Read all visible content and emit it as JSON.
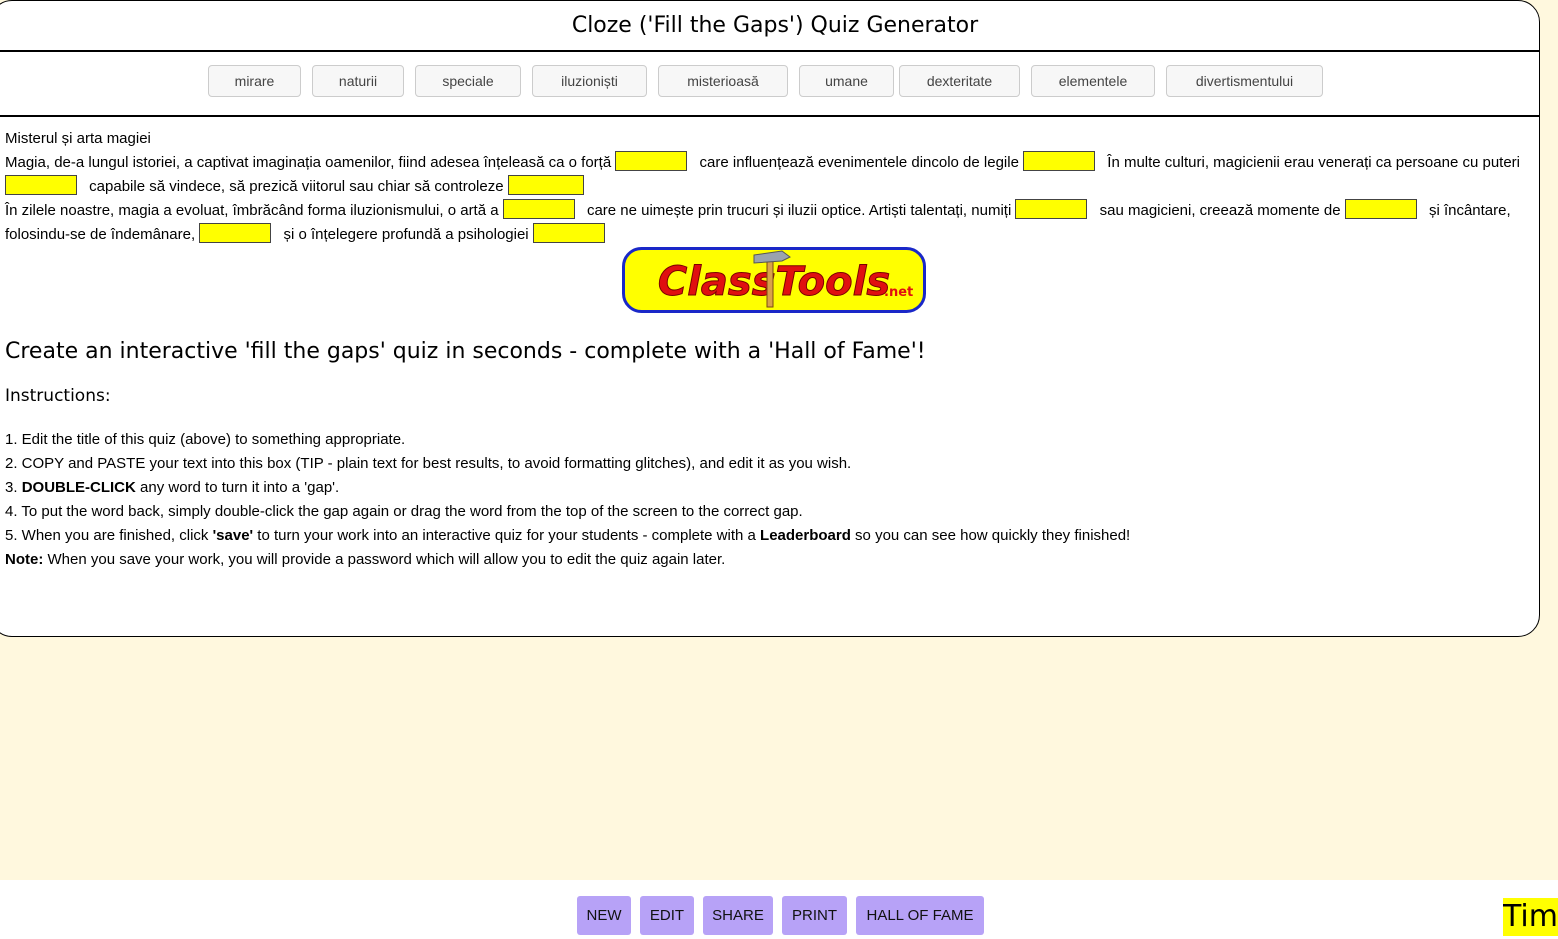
{
  "title": "Cloze ('Fill the Gaps') Quiz Generator",
  "word_bank": [
    "mirare",
    "naturii",
    "speciale",
    "iluzioniști",
    "misterioasă",
    "umane",
    "dexteritate",
    "elementele",
    "divertismentului"
  ],
  "passage": {
    "heading": "Misterul și arta magiei",
    "p1_a": "Magia, de-a lungul istoriei, a captivat imaginația oamenilor, fiind adesea înțeleasă ca o forță",
    "p1_b": "care influențează evenimentele dincolo de legile",
    "p1_c": "În multe culturi, magicienii erau venerați ca persoane cu puteri",
    "p1_d": "capabile să vindece, să prezică viitorul sau chiar să controleze",
    "p2_a": "În zilele noastre, magia a evoluat, îmbrăcând forma iluzionismului, o artă a",
    "p2_b": "care ne uimește prin trucuri și iluzii optice. Artiști talentați, numiți",
    "p2_c": "sau magicieni, creează momente de",
    "p2_d": "și încântare, folosindu-se de îndemânare,",
    "p2_e": "și o înțelegere profundă a psihologiei"
  },
  "logo": {
    "text": "ClassTools",
    "suffix": ".net"
  },
  "main_heading": "Create an interactive 'fill the gaps' quiz in seconds - complete with a 'Hall of Fame'!",
  "instructions_heading": "Instructions:",
  "instructions": {
    "i1": "1. Edit the title of this quiz (above) to something appropriate.",
    "i2": "2. COPY and PASTE your text into this box (TIP - plain text for best results, to avoid formatting glitches), and edit it as you wish.",
    "i3_num": "3. ",
    "i3_bold": "DOUBLE-CLICK",
    "i3_rest": " any word to turn it into a 'gap'.",
    "i4": "4. To put the word back, simply double-click the gap again or drag the word from the top of the screen to the correct gap.",
    "i5_a": "5. When you are finished, click ",
    "i5_bold1": "'save'",
    "i5_b": " to turn your work into an interactive quiz for your students - complete with a ",
    "i5_bold2": "Leaderboard",
    "i5_c": " so you can see how quickly they finished!",
    "note_bold": "Note:",
    "note_rest": " When you save your work, you will provide a password which will allow you to edit the quiz again later."
  },
  "footer": {
    "buttons": [
      "NEW",
      "EDIT",
      "SHARE",
      "PRINT",
      "HALL OF FAME"
    ],
    "timer": "Tim"
  },
  "colors": {
    "background": "#fff8de",
    "gap": "#ffff00",
    "button": "#b7a2f7",
    "logo_bg": "#ffff00",
    "logo_red": "#e01010",
    "logo_border": "#1a28c8"
  }
}
